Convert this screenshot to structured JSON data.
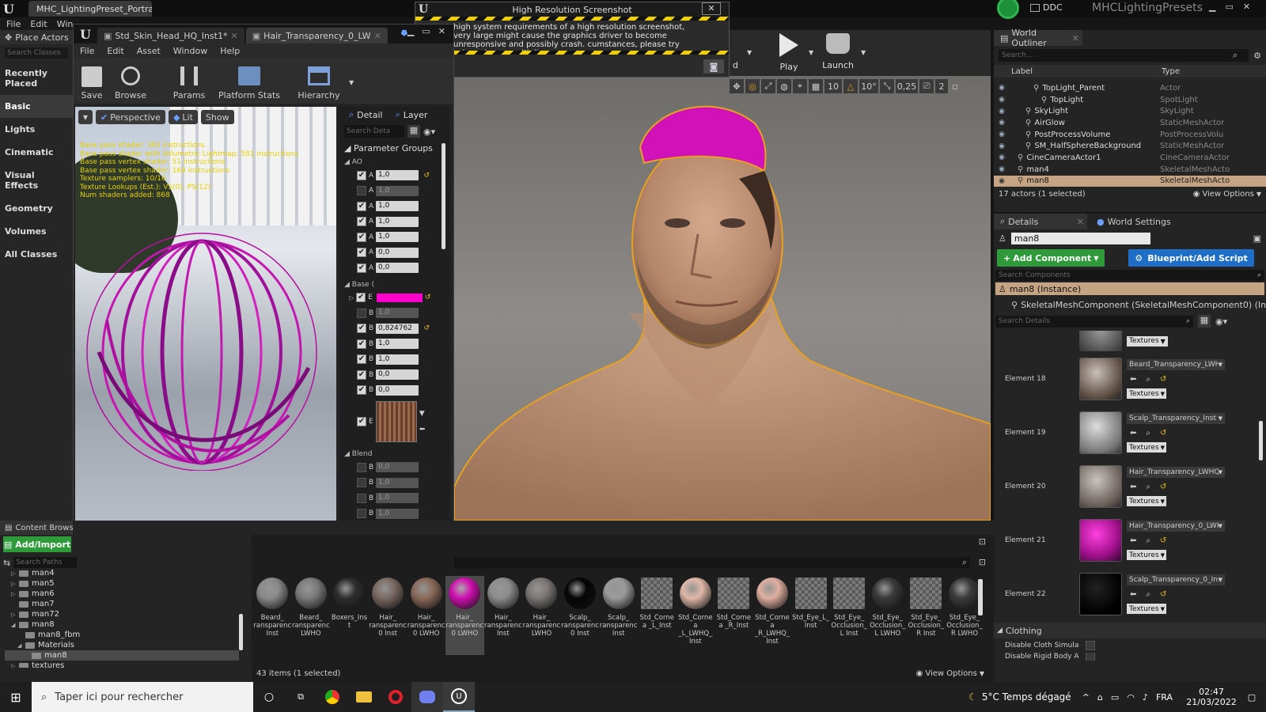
{
  "main": {
    "tab_title": "MHC_LightingPreset_Portra",
    "menu": [
      "File",
      "Edit",
      "Win"
    ],
    "place_actors_label": "Place Actors",
    "search_classes_placeholder": "Search Classes",
    "categories": [
      "Recently Placed",
      "Basic",
      "Lights",
      "Cinematic",
      "Visual Effects",
      "Geometry",
      "Volumes",
      "All Classes"
    ],
    "toolbar": {
      "play": "Play",
      "launch": "Launch",
      "partial_label": "d"
    },
    "ddc_label": "DDC",
    "project_name": "MHCLightingPresets",
    "viewport_tools": {
      "grid_value": "10",
      "rot_value": "10°",
      "scale_value": "0,25",
      "cam_speed": "2"
    }
  },
  "screenshot_dialog": {
    "title": "High Resolution Screenshot",
    "warning": "high system requirements of a high resolution screenshot, very large might cause the graphics driver to become unresponsive and possibly crash. cumstances, please try using a lower multiplier"
  },
  "material_editor": {
    "tabs": [
      "Std_Skin_Head_HQ_Inst1*",
      "Hair_Transparency_0_LW"
    ],
    "menu": [
      "File",
      "Edit",
      "Asset",
      "Window",
      "Help"
    ],
    "toolbar": [
      "Save",
      "Browse",
      "Params",
      "Platform Stats",
      "Hierarchy"
    ],
    "viewport_buttons": {
      "perspective": "Perspective",
      "lit": "Lit",
      "show": "Show"
    },
    "stats": [
      "Base pass shader: 391 instructions",
      "Base pass shader with Volumetric Lightmap: 581 instructions",
      "Base pass vertex shader: 51 instructions",
      "Base pass vertex shader: 160 instructions",
      "Texture samplers: 10/16",
      "Texture Lookups (Est.): VS(0), PS(12)",
      "Num shaders added: 868"
    ],
    "panel_tabs": [
      "Detail",
      "Layer"
    ],
    "search_placeholder": "Search Deta",
    "param_groups_label": "Parameter Groups",
    "group_ao": "AO",
    "group_base": "Base (",
    "group_blend": "Blend",
    "ao_rows": [
      {
        "letter": "A",
        "value": "1,0",
        "checked": true
      },
      {
        "letter": "A",
        "value": "1,0",
        "checked": false
      },
      {
        "letter": "A",
        "value": "1,0",
        "checked": true
      },
      {
        "letter": "A",
        "value": "1,0",
        "checked": true
      },
      {
        "letter": "A",
        "value": "1,0",
        "checked": true
      },
      {
        "letter": "A",
        "value": "0,0",
        "checked": true
      },
      {
        "letter": "A",
        "value": "0,0",
        "checked": true
      }
    ],
    "base_color": "#ff00cc",
    "base_rows": [
      {
        "letter": "B",
        "value": "1,0",
        "checked": false
      },
      {
        "letter": "B",
        "value": "0,824762",
        "checked": true
      },
      {
        "letter": "B",
        "value": "1,0",
        "checked": true
      },
      {
        "letter": "B",
        "value": "1,0",
        "checked": true
      },
      {
        "letter": "B",
        "value": "0,0",
        "checked": true
      },
      {
        "letter": "B",
        "value": "0,0",
        "checked": true
      }
    ],
    "base_texture_letter": "E",
    "blend_rows": [
      {
        "letter": "B",
        "value": "0,0"
      },
      {
        "letter": "B",
        "value": "1,0"
      },
      {
        "letter": "B",
        "value": "1,0"
      },
      {
        "letter": "B",
        "value": "1,0"
      },
      {
        "letter": "B",
        "value": "1,0"
      },
      {
        "letter": "B",
        "value": "0,0"
      },
      {
        "letter": "B",
        "value": "0,0"
      }
    ]
  },
  "outliner": {
    "title": "World Outliner",
    "search_placeholder": "Search...",
    "col_label": "Label",
    "col_type": "Type",
    "rows": [
      {
        "label": "TopLight_Parent",
        "type": "Actor",
        "indent": 3
      },
      {
        "label": "TopLight",
        "type": "SpotLight",
        "indent": 4
      },
      {
        "label": "SkyLight",
        "type": "SkyLight",
        "indent": 2
      },
      {
        "label": "AirGlow",
        "type": "StaticMeshActor",
        "indent": 2
      },
      {
        "label": "PostProcessVolume",
        "type": "PostProcessVolu",
        "indent": 2
      },
      {
        "label": "SM_HalfSphereBackground",
        "type": "StaticMeshActor",
        "indent": 2
      },
      {
        "label": "CineCameraActor1",
        "type": "CineCameraActor",
        "indent": 1
      },
      {
        "label": "man4",
        "type": "SkeletalMeshActo",
        "indent": 1
      },
      {
        "label": "man8",
        "type": "SkeletalMeshActo",
        "indent": 1,
        "selected": true
      }
    ],
    "footer": "17 actors (1 selected)",
    "view_options": "View Options"
  },
  "details": {
    "tab_details": "Details",
    "tab_world": "World Settings",
    "name_value": "man8",
    "add_component": "Add Component",
    "blueprint": "Blueprint/Add Script",
    "search_components": "Search Components",
    "instance_label": "man8 (Instance)",
    "component_label": "SkeletalMeshComponent (SkeletalMeshComponent0) (Inherited)",
    "search_details": "Search Details",
    "textures_label": "Textures",
    "elements": [
      {
        "label": "Element 18",
        "material": "Beard_Transparency_LWHQ"
      },
      {
        "label": "Element 19",
        "material": "Scalp_Transparency_Inst"
      },
      {
        "label": "Element 20",
        "material": "Hair_Transparency_LWHQ_I"
      },
      {
        "label": "Element 21",
        "material": "Hair_Transparency_0_LWHC"
      },
      {
        "label": "Element 22",
        "material": "Scalp_Transparency_0_Inst"
      }
    ],
    "clothing_header": "Clothing",
    "disable_cloth": "Disable Cloth Simulati",
    "disable_rigid": "Disable Rigid Body Ani"
  },
  "content_browser": {
    "title": "Content Brows",
    "add_import": "Add/Import",
    "search_paths": "Search Paths",
    "tree": [
      {
        "label": "man4",
        "indent": 1,
        "arrow": "▷"
      },
      {
        "label": "man5",
        "indent": 1,
        "arrow": "▷"
      },
      {
        "label": "man6",
        "indent": 1,
        "arrow": "▷"
      },
      {
        "label": "man7",
        "indent": 1,
        "arrow": ""
      },
      {
        "label": "man72",
        "indent": 1,
        "arrow": "▷"
      },
      {
        "label": "man8",
        "indent": 1,
        "arrow": "◢"
      },
      {
        "label": "man8_fbm",
        "indent": 2,
        "arrow": ""
      },
      {
        "label": "Materials",
        "indent": 2,
        "arrow": "◢"
      },
      {
        "label": "man8",
        "indent": 3,
        "arrow": "",
        "selected": true
      },
      {
        "label": "textures",
        "indent": 1,
        "arrow": "▷"
      }
    ],
    "assets": [
      {
        "label": "Beard_ ransparenc Inst",
        "ball": "#8a8a8a"
      },
      {
        "label": "Beard_ ransparenc LWHO",
        "ball": "#7b7b7b"
      },
      {
        "label": "Boxers_Inst",
        "ball": "#2e2e2e"
      },
      {
        "label": "Hair_ ransparenc 0 Inst",
        "ball": "#7a6a64"
      },
      {
        "label": "Hair_ ransparenc 0 LWHO",
        "ball": "#8a6a5a"
      },
      {
        "label": "Hair_ ransparenc 0 LWHO",
        "ball": "#d010b0",
        "selected": true
      },
      {
        "label": "Hair_ ransparenc Inst",
        "ball": "#8d8d8d"
      },
      {
        "label": "Hair_ ransparenc LWHO",
        "ball": "#7c7676"
      },
      {
        "label": "Scalp_ ransparenc 0 Inst",
        "ball": "#050505"
      },
      {
        "label": "Scalp_ ransparenc Inst",
        "ball": "#9a9a9a"
      },
      {
        "label": "Std_Cornea _L_Inst",
        "ball": "checker"
      },
      {
        "label": "Std_Cornea _L_LWHQ_ Inst",
        "ball": "#e0b8a8"
      },
      {
        "label": "Std_Cornea _R_Inst",
        "ball": "checker"
      },
      {
        "label": "Std_Cornea _R_LWHQ_ Inst",
        "ball": "#e0b0a0"
      },
      {
        "label": "Std_Eye_L_ Inst",
        "ball": "checker"
      },
      {
        "label": "Std_Eye_ Occlusion_ L Inst",
        "ball": "checker"
      },
      {
        "label": "Std_Eye_ Occlusion_ L LWHO",
        "ball": "#3a3a3a"
      },
      {
        "label": "Std_Eye_ Occlusion_ R Inst",
        "ball": "checker"
      },
      {
        "label": "Std_Eye_ Occlusion_ R LWHO",
        "ball": "#3a3a3a"
      }
    ],
    "items_count": "43 items (1 selected)",
    "view_options": "View Options"
  },
  "taskbar": {
    "search_placeholder": "Taper ici pour rechercher",
    "weather": "5°C  Temps dégagé",
    "lang": "FRA",
    "time": "02:47",
    "date": "21/03/2022"
  }
}
